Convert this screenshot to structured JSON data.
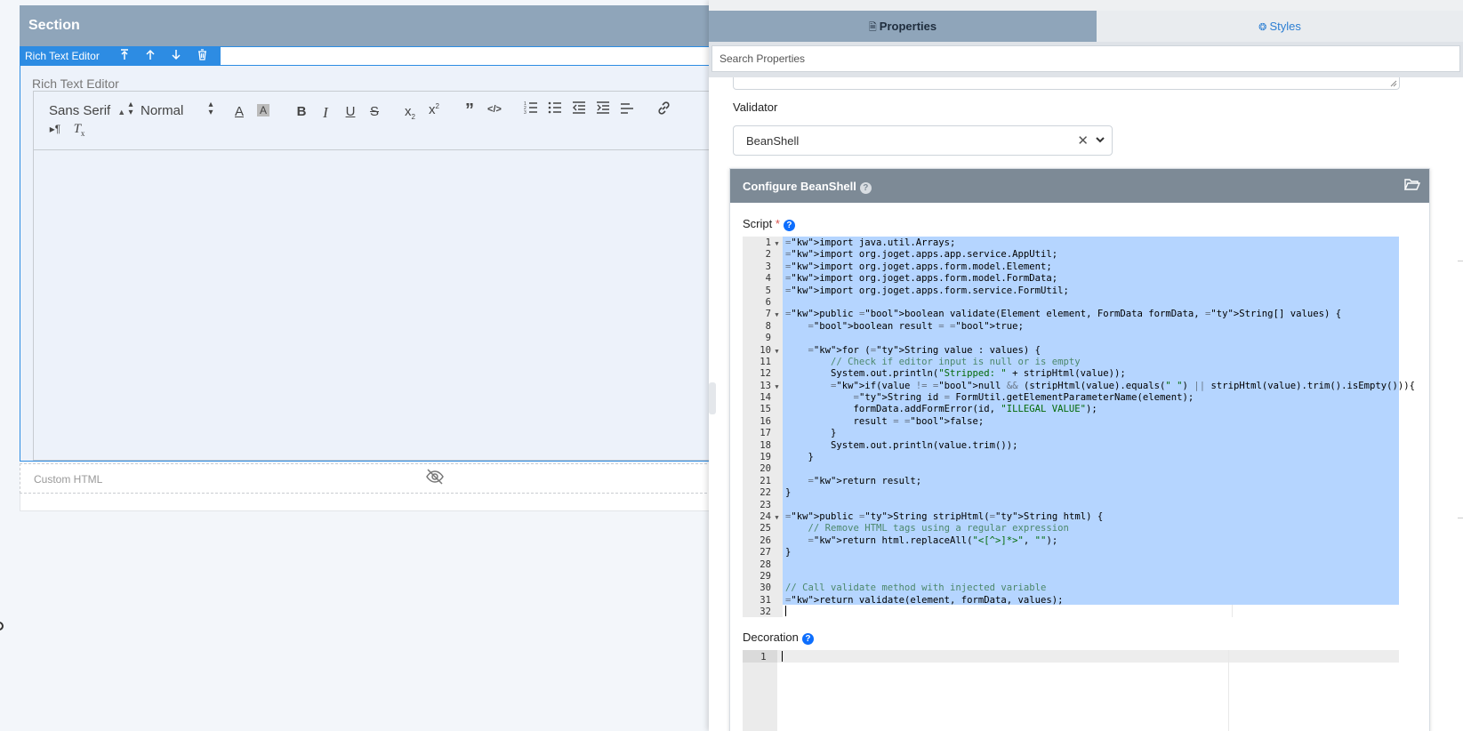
{
  "left": {
    "section_title": "Section",
    "rte_tag_label": "Rich Text Editor",
    "rte_tag_buttons": [
      "move-to-parent-icon",
      "move-up-icon",
      "move-down-icon",
      "delete-icon"
    ],
    "rte_label": "Rich Text Editor",
    "font_family": "Sans Serif",
    "font_size": "Normal",
    "custom_html_label": "Custom HTML"
  },
  "right": {
    "tabs": {
      "properties": "Properties",
      "styles": "Styles"
    },
    "search_placeholder": "Search Properties",
    "validator_label": "Validator",
    "validator_value": "BeanShell",
    "config_title": "Configure BeanShell",
    "script_label": "Script",
    "required_mark": "*",
    "help_mark": "?",
    "decoration_label": "Decoration",
    "decoration_line_number": "1",
    "script_lines": [
      {
        "n": "1",
        "fold": true,
        "t": "import java.util.Arrays;"
      },
      {
        "n": "2",
        "fold": false,
        "t": "import org.joget.apps.app.service.AppUtil;"
      },
      {
        "n": "3",
        "fold": false,
        "t": "import org.joget.apps.form.model.Element;"
      },
      {
        "n": "4",
        "fold": false,
        "t": "import org.joget.apps.form.model.FormData;"
      },
      {
        "n": "5",
        "fold": false,
        "t": "import org.joget.apps.form.service.FormUtil;"
      },
      {
        "n": "6",
        "fold": false,
        "t": ""
      },
      {
        "n": "7",
        "fold": true,
        "t": "public boolean validate(Element element, FormData formData, String[] values) {"
      },
      {
        "n": "8",
        "fold": false,
        "t": "    boolean result = true;"
      },
      {
        "n": "9",
        "fold": false,
        "t": ""
      },
      {
        "n": "10",
        "fold": true,
        "t": "    for (String value : values) {"
      },
      {
        "n": "11",
        "fold": false,
        "t": "        // Check if editor input is null or is empty"
      },
      {
        "n": "12",
        "fold": false,
        "t": "        System.out.println(\"Stripped: \" + stripHtml(value));"
      },
      {
        "n": "13",
        "fold": true,
        "t": "        if(value != null && (stripHtml(value).equals(\" \") || stripHtml(value).trim().isEmpty())){"
      },
      {
        "n": "14",
        "fold": false,
        "t": "            String id = FormUtil.getElementParameterName(element);"
      },
      {
        "n": "15",
        "fold": false,
        "t": "            formData.addFormError(id, \"ILLEGAL VALUE\");"
      },
      {
        "n": "16",
        "fold": false,
        "t": "            result = false;"
      },
      {
        "n": "17",
        "fold": false,
        "t": "        }"
      },
      {
        "n": "18",
        "fold": false,
        "t": "        System.out.println(value.trim());"
      },
      {
        "n": "19",
        "fold": false,
        "t": "    }"
      },
      {
        "n": "20",
        "fold": false,
        "t": ""
      },
      {
        "n": "21",
        "fold": false,
        "t": "    return result;"
      },
      {
        "n": "22",
        "fold": false,
        "t": "}"
      },
      {
        "n": "23",
        "fold": false,
        "t": ""
      },
      {
        "n": "24",
        "fold": true,
        "t": "public String stripHtml(String html) {"
      },
      {
        "n": "25",
        "fold": false,
        "t": "    // Remove HTML tags using a regular expression"
      },
      {
        "n": "26",
        "fold": false,
        "t": "    return html.replaceAll(\"<[^>]*>\", \"\");"
      },
      {
        "n": "27",
        "fold": false,
        "t": "}"
      },
      {
        "n": "28",
        "fold": false,
        "t": ""
      },
      {
        "n": "29",
        "fold": false,
        "t": ""
      },
      {
        "n": "30",
        "fold": false,
        "t": "// Call validate method with injected variable"
      },
      {
        "n": "31",
        "fold": false,
        "t": "return validate(element, formData, values);"
      },
      {
        "n": "32",
        "fold": false,
        "t": ""
      }
    ]
  },
  "colors": {
    "section_header": "#8fa5ba",
    "selection_blue": "#2d8ce3",
    "code_selection": "#b5d5ff",
    "config_header": "#7d8a96"
  }
}
